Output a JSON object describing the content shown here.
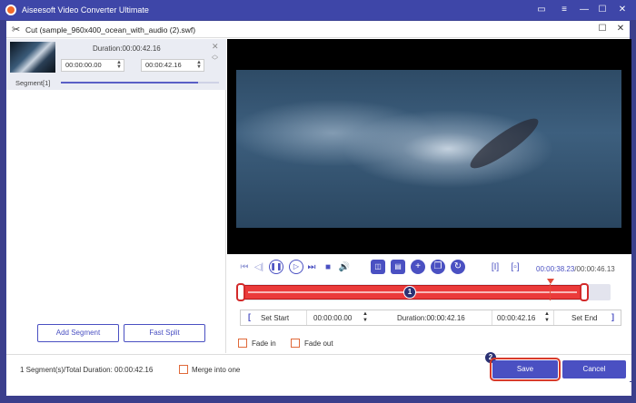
{
  "app": {
    "title": "Aiseesoft Video Converter Ultimate"
  },
  "dialog": {
    "title": "Cut (sample_960x400_ocean_with_audio (2).swf)"
  },
  "segment": {
    "duration": "Duration:00:00:42.16",
    "start": "00:00:00.00",
    "end": "00:00:42.16",
    "label": "Segment[1]",
    "progress": 0.87
  },
  "left_buttons": {
    "add_segment": "Add Segment",
    "fast_split": "Fast Split"
  },
  "player": {
    "current_time": "00:00:38.23",
    "total_time": "/00:00:46.13"
  },
  "timeline": {
    "start": "00:00:00.00",
    "duration": "Duration:00:00:42.16",
    "end": "00:00:42.16",
    "set_start": "Set Start",
    "set_end": "Set End"
  },
  "effects": {
    "fade_in": "Fade in",
    "fade_out": "Fade out"
  },
  "footer": {
    "summary": "1 Segment(s)/Total Duration: 00:00:42.16",
    "merge": "Merge into one",
    "save": "Save",
    "cancel": "Cancel"
  },
  "badges": {
    "one": "1",
    "two": "2"
  },
  "colors": {
    "accent": "#4a50c2",
    "title_bar": "#3e46a8",
    "selection": "#eb3a3a"
  }
}
